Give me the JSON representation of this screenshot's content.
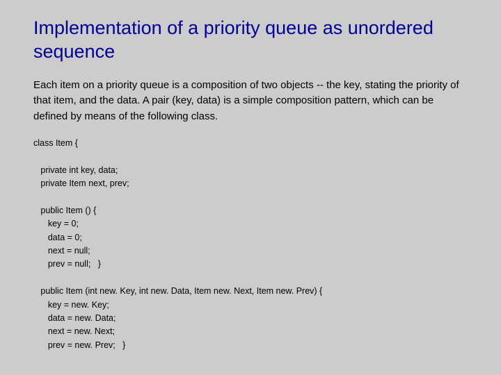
{
  "title": "Implementation of a priority queue as unordered sequence",
  "paragraph": "Each item on a priority queue is a composition of two objects -- the key, stating the priority of that item, and the data. A pair (key, data) is a simple composition pattern, which can be defined by means of the following class.",
  "code": "class Item {\n\n   private int key, data;\n   private Item next, prev;\n\n   public Item () {\n      key = 0;\n      data = 0;\n      next = null;\n      prev = null;   }\n\n   public Item (int new. Key, int new. Data, Item new. Next, Item new. Prev) {\n      key = new. Key;\n      data = new. Data;\n      next = new. Next;\n      prev = new. Prev;   }"
}
